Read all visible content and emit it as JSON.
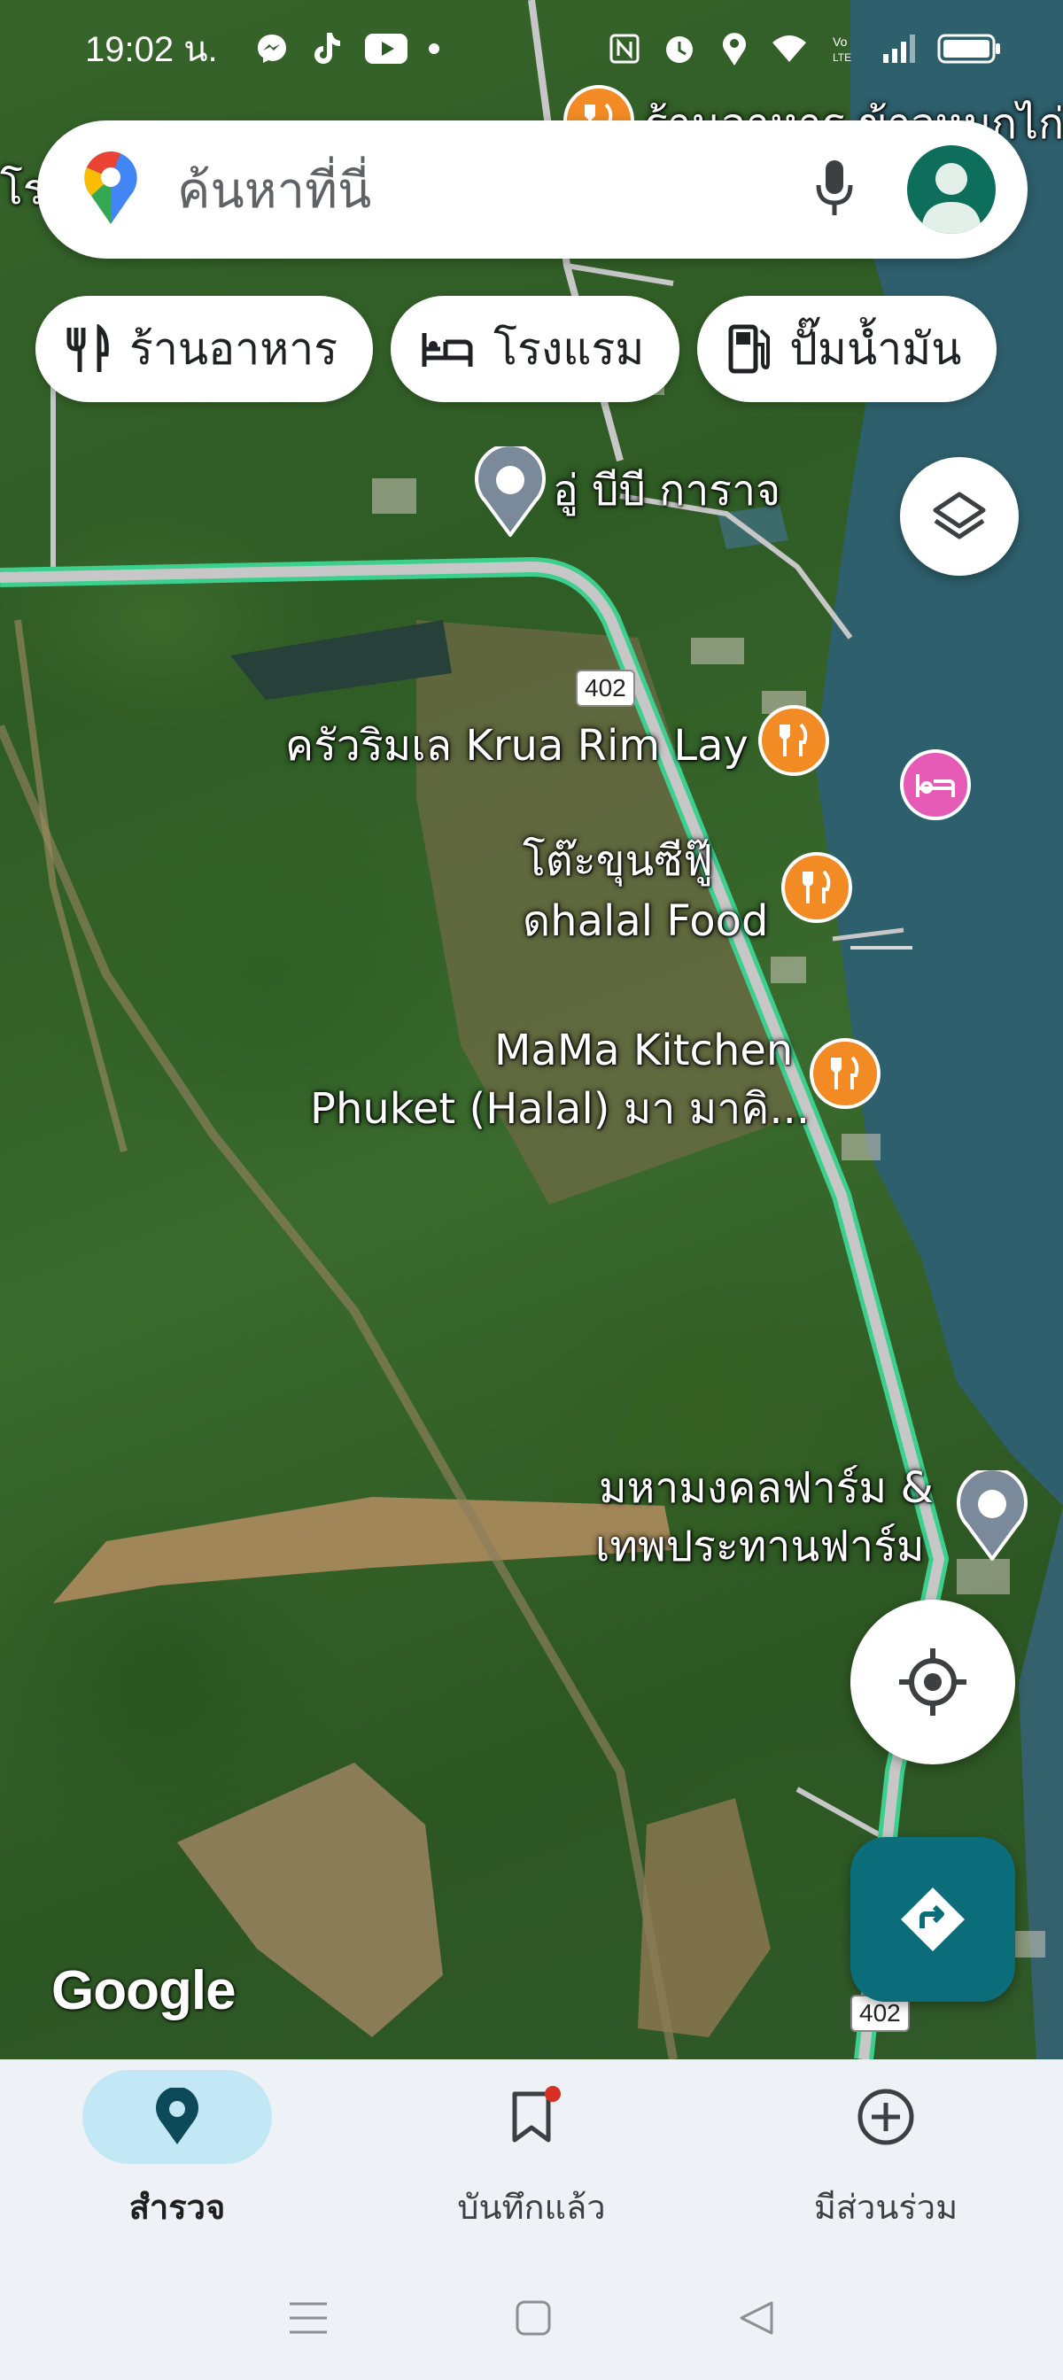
{
  "status_bar": {
    "time": "19:02 น.",
    "icons": [
      "messenger-icon",
      "tiktok-icon",
      "youtube-icon",
      "dot-icon",
      "nfc-icon",
      "alarm-icon",
      "location-icon",
      "wifi-icon",
      "volte-icon",
      "signal-icon",
      "battery-icon"
    ]
  },
  "search": {
    "placeholder": "ค้นหาที่นี่",
    "icons": [
      "google-maps-logo-icon",
      "microphone-icon",
      "account-avatar-icon"
    ]
  },
  "chips": [
    {
      "label": "ร้านอาหาร",
      "icon": "restaurant-icon"
    },
    {
      "label": "โรงแรม",
      "icon": "hotel-icon"
    },
    {
      "label": "ปั๊มน้ำมัน",
      "icon": "gas-station-icon"
    }
  ],
  "map": {
    "places": {
      "top_partial": "ร้านอาหาร ข้าวหมกไก่",
      "left_partial": "โร",
      "garage": "อู่ บีบี การาจ",
      "krua_rim_lay": "ครัวริมเล Krua Rim Lay",
      "seafood_line1": "โต๊ะขุนซีฟู๊",
      "seafood_line2": "ดhalal Food",
      "mama_line1": "MaMa Kitchen",
      "mama_line2": "Phuket (Halal) มา มาคิ...",
      "farm_line1": "มหามงคลฟาร์ม &",
      "farm_line2": "เทพประทานฟาร์ม"
    },
    "road_number": "402",
    "road_number_bottom": "402",
    "attribution": "Google",
    "colors": {
      "route": "#3ccf8e",
      "road": "#c7c7c7",
      "sea": "#2e5f6c",
      "restaurant_pin": "#f28b24",
      "hotel_pin": "#e55bb6",
      "generic_pin": "#7a8a9a"
    }
  },
  "controls": {
    "layers": "layers-icon",
    "my_location": "my-location-icon",
    "directions": "directions-icon",
    "directions_color": "#0b6c7a"
  },
  "bottom_nav": [
    {
      "label": "สำรวจ",
      "icon": "location-pin-icon",
      "active": true
    },
    {
      "label": "บันทึกแล้ว",
      "icon": "bookmark-icon",
      "active": false
    },
    {
      "label": "มีส่วนร่วม",
      "icon": "add-circle-icon",
      "active": false
    }
  ],
  "system_nav": [
    "menu-icon",
    "home-icon",
    "back-icon"
  ]
}
